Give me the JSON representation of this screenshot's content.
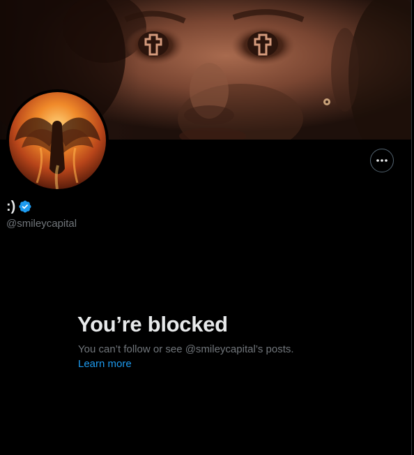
{
  "profile": {
    "display_name": ":)",
    "handle": "@smileycapital",
    "verified": true,
    "verified_icon": "verified-badge-icon",
    "avatar_icon": "phoenix-avatar-image",
    "banner_icon": "face-with-crosses-banner-image"
  },
  "actions": {
    "more_icon": "more-horizontal-icon"
  },
  "blocked": {
    "title": "You’re blocked",
    "description": "You can’t follow or see @smileycapital’s posts.",
    "learn_more": "Learn more"
  },
  "colors": {
    "background": "#000000",
    "primary_text": "#e7e9ea",
    "secondary_text": "#71767b",
    "link": "#1d9bf0",
    "verified": "#1d9bf0",
    "border": "#536471"
  }
}
